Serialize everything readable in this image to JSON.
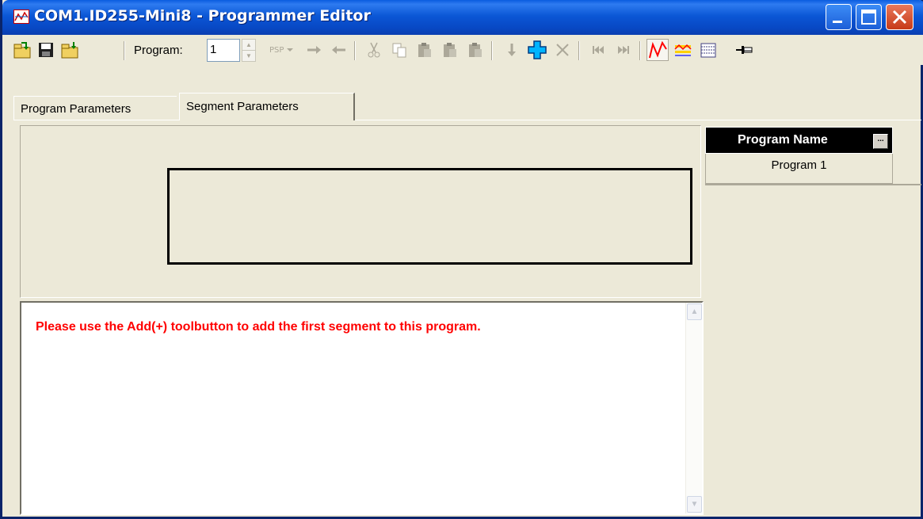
{
  "window": {
    "title": "COM1.ID255-Mini8 - Programmer Editor"
  },
  "toolbar": {
    "program_label": "Program:",
    "program_value": "1",
    "icons": [
      "open-icon",
      "save-icon",
      "download-icon",
      "psp-icon",
      "arrow-right-icon",
      "arrow-left-icon",
      "cut-icon",
      "copy-icon",
      "paste-icon",
      "paste-before-icon",
      "paste-after-icon",
      "insert-down-icon",
      "add-segment-icon",
      "delete-icon",
      "first-icon",
      "last-icon",
      "trend-icon",
      "program-view-icon",
      "table-view-icon",
      "pin-icon"
    ]
  },
  "tabs": [
    {
      "label": "Program Parameters",
      "active": false
    },
    {
      "label": "Segment Parameters",
      "active": true
    }
  ],
  "message": "Please use the Add(+) toolbutton to add the first segment to this program.",
  "grid": {
    "header": "Program Name",
    "header_button": "...",
    "rows": [
      "Program 1"
    ]
  },
  "colors": {
    "message": "#ff0000",
    "titlebar": "#0b57d6",
    "add_icon": "#00b4ff",
    "trend_icon": "#ff0000"
  }
}
